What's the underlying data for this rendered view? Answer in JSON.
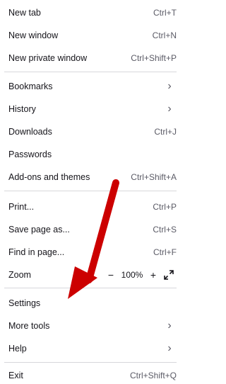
{
  "menu": {
    "new_tab": {
      "label": "New tab",
      "shortcut": "Ctrl+T"
    },
    "new_window": {
      "label": "New window",
      "shortcut": "Ctrl+N"
    },
    "new_private_window": {
      "label": "New private window",
      "shortcut": "Ctrl+Shift+P"
    },
    "bookmarks": {
      "label": "Bookmarks"
    },
    "history": {
      "label": "History"
    },
    "downloads": {
      "label": "Downloads",
      "shortcut": "Ctrl+J"
    },
    "passwords": {
      "label": "Passwords"
    },
    "addons": {
      "label": "Add-ons and themes",
      "shortcut": "Ctrl+Shift+A"
    },
    "print": {
      "label": "Print...",
      "shortcut": "Ctrl+P"
    },
    "save_page": {
      "label": "Save page as...",
      "shortcut": "Ctrl+S"
    },
    "find": {
      "label": "Find in page...",
      "shortcut": "Ctrl+F"
    },
    "zoom": {
      "label": "Zoom",
      "minus": "−",
      "value": "100%",
      "plus": "+"
    },
    "settings": {
      "label": "Settings"
    },
    "more_tools": {
      "label": "More tools"
    },
    "help": {
      "label": "Help"
    },
    "exit": {
      "label": "Exit",
      "shortcut": "Ctrl+Shift+Q"
    }
  },
  "icons": {
    "submenu": "chevron-right-icon",
    "fullscreen": "fullscreen-icon",
    "annotation": "red-arrow"
  },
  "colors": {
    "text": "#15141a",
    "secondary": "#5b5b66",
    "separator": "#d7d7db",
    "arrow": "#cc0000"
  }
}
